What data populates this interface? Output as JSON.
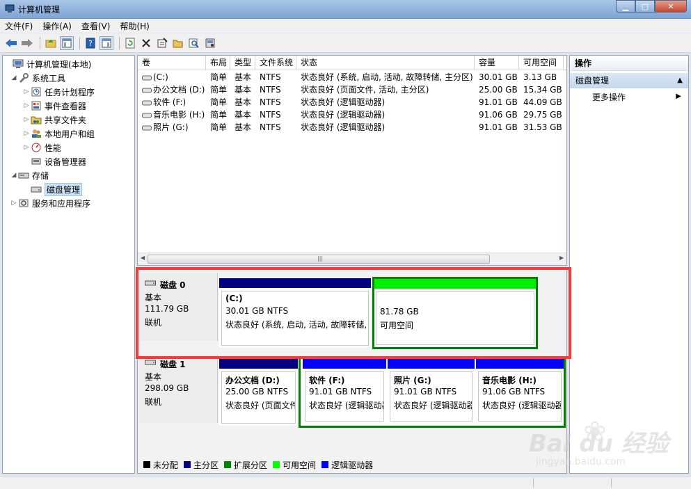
{
  "window": {
    "title": "计算机管理"
  },
  "menu": [
    "文件(F)",
    "操作(A)",
    "查看(V)",
    "帮助(H)"
  ],
  "toolbar_icons": [
    "back-icon",
    "forward-icon",
    "up-folder-icon",
    "show-tree-icon",
    "help-icon",
    "show-action-pane-icon",
    "refresh-icon",
    "delete-icon",
    "properties-icon",
    "open-icon",
    "find-icon",
    "disk-check-icon"
  ],
  "tree": {
    "items": [
      {
        "label": "计算机管理(本地)",
        "level": 0,
        "arrow": ""
      },
      {
        "label": "系统工具",
        "level": 1,
        "arrow": "◢"
      },
      {
        "label": "任务计划程序",
        "level": 2,
        "arrow": "▷"
      },
      {
        "label": "事件查看器",
        "level": 2,
        "arrow": "▷"
      },
      {
        "label": "共享文件夹",
        "level": 2,
        "arrow": "▷"
      },
      {
        "label": "本地用户和组",
        "level": 2,
        "arrow": "▷"
      },
      {
        "label": "性能",
        "level": 2,
        "arrow": "▷"
      },
      {
        "label": "设备管理器",
        "level": 2,
        "arrow": ""
      },
      {
        "label": "存储",
        "level": 1,
        "arrow": "◢"
      },
      {
        "label": "磁盘管理",
        "level": 2,
        "arrow": ""
      },
      {
        "label": "服务和应用程序",
        "level": 1,
        "arrow": "▷"
      }
    ]
  },
  "volumes": {
    "headers": [
      "卷",
      "布局",
      "类型",
      "文件系统",
      "状态",
      "容量",
      "可用空间"
    ],
    "rows": [
      [
        "(C:)",
        "简单",
        "基本",
        "NTFS",
        "状态良好 (系统, 启动, 活动, 故障转储, 主分区)",
        "30.01 GB",
        "3.13 GB"
      ],
      [
        "办公文档 (D:)",
        "简单",
        "基本",
        "NTFS",
        "状态良好 (页面文件, 活动, 主分区)",
        "25.00 GB",
        "15.34 GB"
      ],
      [
        "软件 (F:)",
        "简单",
        "基本",
        "NTFS",
        "状态良好 (逻辑驱动器)",
        "91.01 GB",
        "44.09 GB"
      ],
      [
        "音乐电影 (H:)",
        "简单",
        "基本",
        "NTFS",
        "状态良好 (逻辑驱动器)",
        "91.06 GB",
        "29.75 GB"
      ],
      [
        "照片 (G:)",
        "简单",
        "基本",
        "NTFS",
        "状态良好 (逻辑驱动器)",
        "91.01 GB",
        "31.53 GB"
      ]
    ]
  },
  "disk0": {
    "name": "磁盘 0",
    "type": "基本",
    "size": "111.79 GB",
    "status": "联机",
    "c": {
      "title": "(C:)",
      "size": "30.01 GB NTFS",
      "status": "状态良好 (系统, 启动, 活动, 故障转储,"
    },
    "free": {
      "size": "81.78 GB",
      "status": "可用空间"
    }
  },
  "disk1": {
    "name": "磁盘 1",
    "type": "基本",
    "size": "298.09 GB",
    "status": "联机",
    "d": {
      "title": "办公文档 (D:)",
      "size": "25.00 GB NTFS",
      "status": "状态良好 (页面文件"
    },
    "f": {
      "title": "软件 (F:)",
      "size": "91.01 GB NTFS",
      "status": "状态良好 (逻辑驱动器"
    },
    "g": {
      "title": "照片 (G:)",
      "size": "91.01 GB NTFS",
      "status": "状态良好 (逻辑驱动器"
    },
    "h": {
      "title": "音乐电影 (H:)",
      "size": "91.06 GB NTFS",
      "status": "状态良好 (逻辑驱动器"
    }
  },
  "legend": [
    {
      "label": "未分配",
      "color": "#000000"
    },
    {
      "label": "主分区",
      "color": "#000080"
    },
    {
      "label": "扩展分区",
      "color": "#008000"
    },
    {
      "label": "可用空间",
      "color": "#00ff00"
    },
    {
      "label": "逻辑驱动器",
      "color": "#0000ff"
    }
  ],
  "actions": {
    "header": "操作",
    "section": "磁盘管理",
    "more": "更多操作"
  },
  "watermark": {
    "brand": "Bai du 经验",
    "site": "jingyan.baidu.com"
  }
}
